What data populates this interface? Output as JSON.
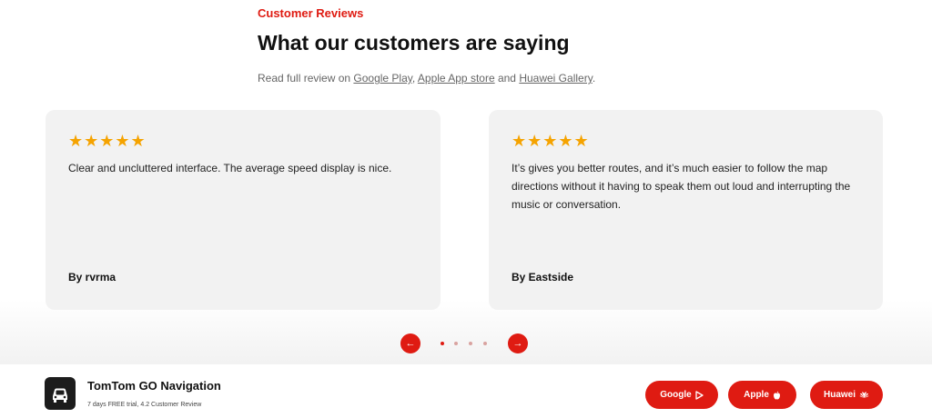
{
  "section": {
    "eyebrow": "Customer Reviews",
    "heading": "What our customers are saying",
    "subtext_prefix": "Read full review on ",
    "link_google": "Google Play",
    "sep1": ", ",
    "link_apple": "Apple App store",
    "sep2": " and ",
    "link_huawei": "Huawei Gallery",
    "subtext_suffix": "."
  },
  "reviews": [
    {
      "stars": "★★★★★",
      "rating": 5,
      "text": "Clear and uncluttered interface. The average speed display is nice.",
      "author": "By rvrma"
    },
    {
      "stars": "★★★★★",
      "rating": 5,
      "text": "It’s gives you better routes, and it’s much easier to follow the map directions without it having to speak them out loud and interrupting the music or conversation.",
      "author": "By Eastside"
    }
  ],
  "carousel": {
    "prev_icon": "arrow-left-icon",
    "next_icon": "arrow-right-icon",
    "prev_glyph": "←",
    "next_glyph": "→",
    "dot_count": 4,
    "active_dot": 1
  },
  "app_bar": {
    "app_name": "TomTom GO Navigation",
    "app_sub": "7 days FREE trial, 4.2 Customer Review",
    "buttons": {
      "google": "Google",
      "apple": "Apple",
      "huawei": "Huawei"
    }
  },
  "colors": {
    "accent": "#df1b12",
    "star": "#f5a300",
    "card_bg": "#f2f2f2"
  }
}
